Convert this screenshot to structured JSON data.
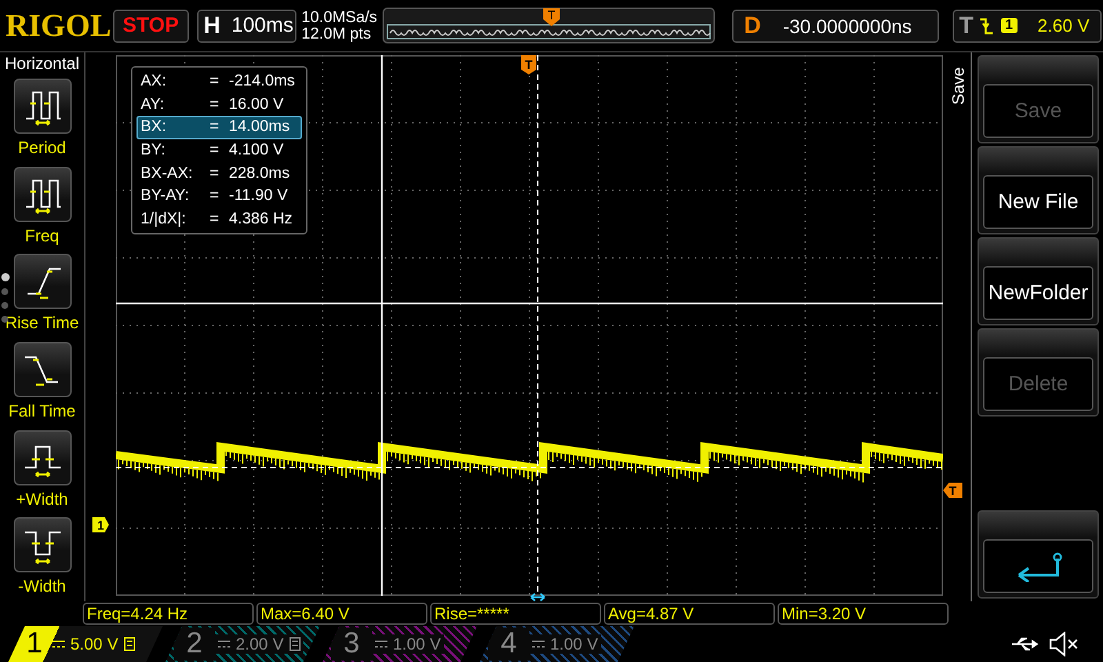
{
  "header": {
    "logo": "RIGOL",
    "run_state": "STOP",
    "timebase": {
      "label": "H",
      "value": "100ms"
    },
    "sample_rate": "10.0MSa/s",
    "memory_depth": "12.0M pts",
    "memory_marker": "T",
    "delay": {
      "label": "D",
      "value": "-30.0000000ns"
    },
    "trigger": {
      "label": "T",
      "source": "1",
      "level": "2.60 V"
    }
  },
  "sidebar": {
    "title": "Horizontal",
    "items": [
      {
        "kind": "period",
        "label": "Period"
      },
      {
        "kind": "freq",
        "label": "Freq"
      },
      {
        "kind": "rise_time",
        "label": "Rise Time"
      },
      {
        "kind": "fall_time",
        "label": "Fall Time"
      },
      {
        "kind": "pos_width",
        "label": "+Width"
      },
      {
        "kind": "neg_width",
        "label": "-Width"
      }
    ],
    "page_dots": [
      {
        "selected": true
      },
      {
        "selected": false
      },
      {
        "selected": false
      },
      {
        "selected": false
      }
    ]
  },
  "screen": {
    "trigger_marker_top": "T",
    "trigger_marker_right": "T",
    "channel_marker": "1",
    "cursor_readout": [
      {
        "label": "AX:",
        "sign": "=",
        "value": "-214.0ms",
        "selected": false
      },
      {
        "label": "AY:",
        "sign": "=",
        "value": "16.00 V",
        "selected": false
      },
      {
        "label": "BX:",
        "sign": "=",
        "value": "14.00ms",
        "selected": true
      },
      {
        "label": "BY:",
        "sign": "=",
        "value": "4.100 V",
        "selected": false
      },
      {
        "label": "BX-AX:",
        "sign": "=",
        "value": "228.0ms",
        "selected": false
      },
      {
        "label": "BY-AY:",
        "sign": "=",
        "value": "-11.90 V",
        "selected": false
      },
      {
        "label": "1/|dX|:",
        "sign": "=",
        "value": "4.386 Hz",
        "selected": false
      }
    ]
  },
  "softkey_menu": {
    "title": "Save",
    "buttons": [
      {
        "kind": "text",
        "label": "Save",
        "disabled": true
      },
      {
        "kind": "text",
        "label": "New File",
        "disabled": false
      },
      {
        "kind": "text",
        "label": "NewFolder",
        "disabled": false
      },
      {
        "kind": "text",
        "label": "Delete",
        "disabled": true
      },
      {
        "kind": "blank"
      },
      {
        "kind": "back"
      }
    ]
  },
  "measurements": [
    "Freq=4.24 Hz",
    "Max=6.40 V",
    "Rise=*****",
    "Avg=4.87 V",
    "Min=3.20 V"
  ],
  "channels": [
    {
      "number": "1",
      "scale": "5.00 V",
      "on": true,
      "color": "#f0f000",
      "impedance_mark": true
    },
    {
      "number": "2",
      "scale": "2.00 V",
      "on": false,
      "color": "#006a6a",
      "impedance_mark": true
    },
    {
      "number": "3",
      "scale": "1.00 V",
      "on": false,
      "color": "#7a107a",
      "impedance_mark": false
    },
    {
      "number": "4",
      "scale": "1.00 V",
      "on": false,
      "color": "#1e4a80",
      "impedance_mark": false
    }
  ]
}
